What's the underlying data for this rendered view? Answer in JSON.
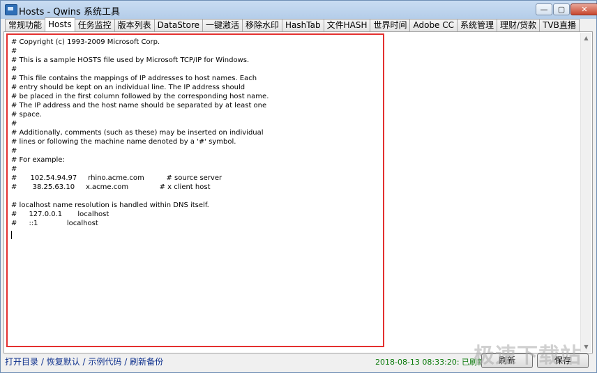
{
  "window": {
    "title": "Hosts - Qwins 系统工具",
    "controls": {
      "minimize": "—",
      "maximize": "▢",
      "close": "✕"
    },
    "icon": "app-window-icon"
  },
  "tabs": [
    {
      "label": "常规功能",
      "active": false
    },
    {
      "label": "Hosts",
      "active": true
    },
    {
      "label": "任务监控",
      "active": false
    },
    {
      "label": "版本列表",
      "active": false
    },
    {
      "label": "DataStore",
      "active": false
    },
    {
      "label": "一键激活",
      "active": false
    },
    {
      "label": "移除水印",
      "active": false
    },
    {
      "label": "HashTab",
      "active": false
    },
    {
      "label": "文件HASH",
      "active": false
    },
    {
      "label": "世界时间",
      "active": false
    },
    {
      "label": "Adobe CC",
      "active": false
    },
    {
      "label": "系统管理",
      "active": false
    },
    {
      "label": "理财/贷款",
      "active": false
    },
    {
      "label": "TVB直播",
      "active": false
    }
  ],
  "editor": {
    "content": "# Copyright (c) 1993-2009 Microsoft Corp.\n#\n# This is a sample HOSTS file used by Microsoft TCP/IP for Windows.\n#\n# This file contains the mappings of IP addresses to host names. Each\n# entry should be kept on an individual line. The IP address should\n# be placed in the first column followed by the corresponding host name.\n# The IP address and the host name should be separated by at least one\n# space.\n#\n# Additionally, comments (such as these) may be inserted on individual\n# lines or following the machine name denoted by a '#' symbol.\n#\n# For example:\n#\n#      102.54.94.97     rhino.acme.com          # source server\n#       38.25.63.10     x.acme.com              # x client host\n\n# localhost name resolution is handled within DNS itself.\n#\t127.0.0.1       localhost\n#\t::1             localhost"
  },
  "scrollbar": {
    "up_arrow": "▲",
    "down_arrow": "▼"
  },
  "footer": {
    "links": [
      "打开目录",
      "恢复默认",
      "示例代码",
      "刷新备份"
    ],
    "separator": " / ",
    "status": "2018-08-13 08:33:20: 已刷新",
    "refresh_button": "刷新",
    "save_button": "保存"
  },
  "watermark": "极速下载站"
}
